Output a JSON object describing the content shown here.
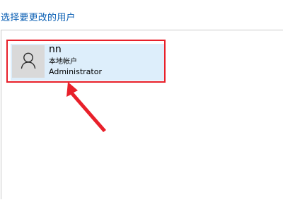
{
  "header": {
    "title": "选择要更改的用户"
  },
  "users": [
    {
      "name": "nn",
      "account_type": "本地帐户",
      "role": "Administrator",
      "avatar_icon": "user-silhouette-icon"
    }
  ],
  "colors": {
    "heading": "#0a5fb4",
    "tile_selected_bg": "#ddeefb",
    "annotation_red": "#e8202a",
    "avatar_bg": "#d9d9d9"
  },
  "annotation": {
    "icon": "red-arrow-icon"
  }
}
